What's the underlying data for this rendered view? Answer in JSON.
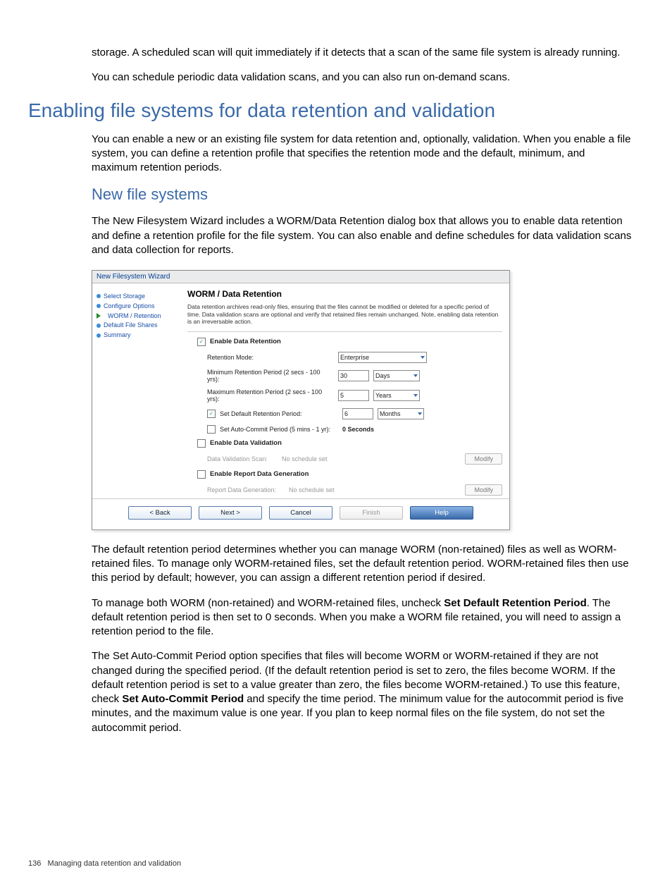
{
  "intro": {
    "p1": "storage. A scheduled scan will quit immediately if it detects that a scan of the same file system is already running.",
    "p2": "You can schedule periodic data validation scans, and you can also run on-demand scans."
  },
  "section": {
    "heading": "Enabling file systems for data retention and validation",
    "p1": "You can enable a new or an existing file system for data retention and, optionally, validation. When you enable a file system, you can define a retention profile that specifies the retention mode and the default, minimum, and maximum retention periods."
  },
  "sub": {
    "heading": "New file systems",
    "p1": "The New Filesystem Wizard includes a WORM/Data Retention dialog box that allows you to enable data retention and define a retention profile for the file system. You can also enable and define schedules for data validation scans and data collection for reports."
  },
  "wizard": {
    "title": "New Filesystem Wizard",
    "sidebar": {
      "items": [
        "Select Storage",
        "Configure Options",
        "WORM / Retention",
        "Default File Shares",
        "Summary"
      ],
      "active_index": 2
    },
    "content": {
      "heading": "WORM / Data Retention",
      "desc": "Data retention archives read-only files, ensuring that the files cannot be modified or deleted for a specific period of time. Data validation scans are optional and verify that retained files remain unchanged. Note, enabling data retention is an irreversable action.",
      "enable_retention_label": "Enable Data Retention",
      "retention_mode_label": "Retention Mode:",
      "retention_mode_value": "Enterprise",
      "min_ret_label": "Minimum Retention Period (2 secs - 100 yrs):",
      "min_ret_value": "30",
      "min_ret_unit": "Days",
      "max_ret_label": "Maximum Retention Period (2 secs - 100 yrs):",
      "max_ret_value": "5",
      "max_ret_unit": "Years",
      "set_default_label": "Set Default Retention Period:",
      "default_value": "6",
      "default_unit": "Months",
      "autocommit_label": "Set Auto-Commit Period (5 mins - 1 yr):",
      "autocommit_value": "0 Seconds",
      "enable_validation_label": "Enable Data Validation",
      "validation_scan_label": "Data Validation Scan:",
      "no_schedule": "No schedule set",
      "modify_label": "Modify",
      "enable_report_label": "Enable Report Data Generation",
      "report_gen_label": "Report Data Generation:"
    },
    "footer": {
      "back": "< Back",
      "next": "Next >",
      "cancel": "Cancel",
      "finish": "Finish",
      "help": "Help"
    }
  },
  "after": {
    "p1": "The default retention period determines whether you can manage WORM (non-retained) files as well as WORM-retained files. To manage only WORM-retained files, set the default retention period. WORM-retained files then use this period by default; however, you can assign a different retention period if desired.",
    "p2a": "To manage both WORM (non-retained) and WORM-retained files, uncheck ",
    "p2b": "Set Default Retention Period",
    "p2c": ". The default retention period is then set to 0 seconds. When you make a WORM file retained, you will need to assign a retention period to the file.",
    "p3a": "The Set Auto-Commit Period option specifies that files will become WORM or WORM-retained if they are not changed during the specified period. (If the default retention period is set to zero, the files become WORM. If the default retention period is set to a value greater than zero, the files become WORM-retained.) To use this feature, check ",
    "p3b": "Set Auto-Commit Period",
    "p3c": " and specify the time period. The minimum value for the autocommit period is five minutes, and the maximum value is one year. If you plan to keep normal files on the file system, do not set the autocommit period."
  },
  "footer": {
    "page_num": "136",
    "page_title": "Managing data retention and validation"
  }
}
